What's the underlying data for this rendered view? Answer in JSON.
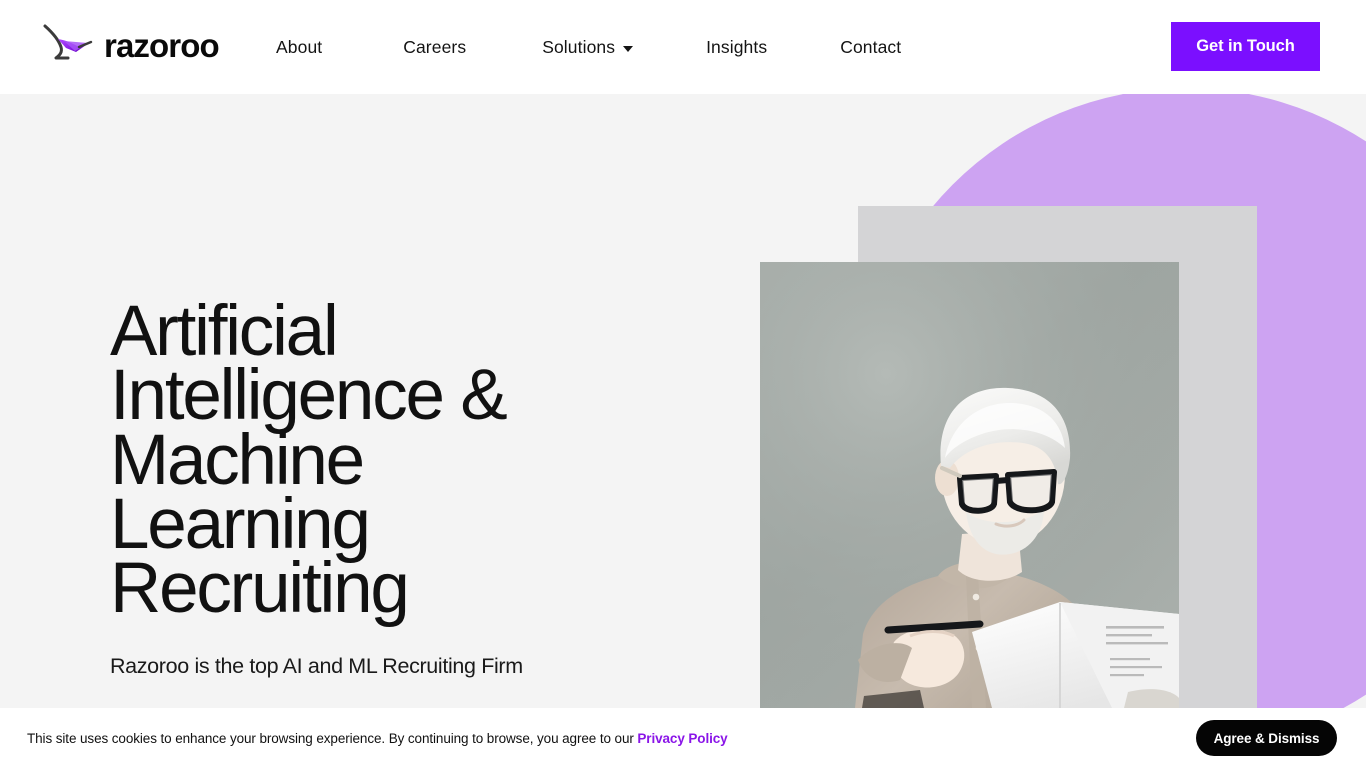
{
  "header": {
    "logo": {
      "wordmark": "razoroo",
      "mark_icon": "razoroo-kangaroo-logo-icon"
    },
    "nav": [
      {
        "label": "About",
        "has_dropdown": false
      },
      {
        "label": "Careers",
        "has_dropdown": false
      },
      {
        "label": "Solutions",
        "has_dropdown": true
      },
      {
        "label": "Insights",
        "has_dropdown": false
      },
      {
        "label": "Contact",
        "has_dropdown": false
      }
    ],
    "cta": {
      "label": "Get in Touch"
    }
  },
  "hero": {
    "title": "Artificial\nIntelligence &\nMachine\nLearning\nRecruiting",
    "subtitle": "Razoroo is the top AI and ML Recruiting Firm",
    "image_alt": "Man with white hair and black glasses reading a document while holding a pen"
  },
  "cookie_banner": {
    "message_before_link": "This site uses cookies to enhance your browsing experience. By continuing to browse, you agree to our ",
    "link_label": "Privacy Policy",
    "dismiss_label": "Agree & Dismiss"
  },
  "colors": {
    "brand_purple": "#7b0fff",
    "blob_purple": "#cda3f2",
    "link_purple": "#8a15e8",
    "page_background": "#f4f4f4",
    "header_background": "#ffffff",
    "text_dark": "#111111",
    "photo_backdrop_gray": "#d4d4d6",
    "cookie_button_black": "#050505"
  }
}
